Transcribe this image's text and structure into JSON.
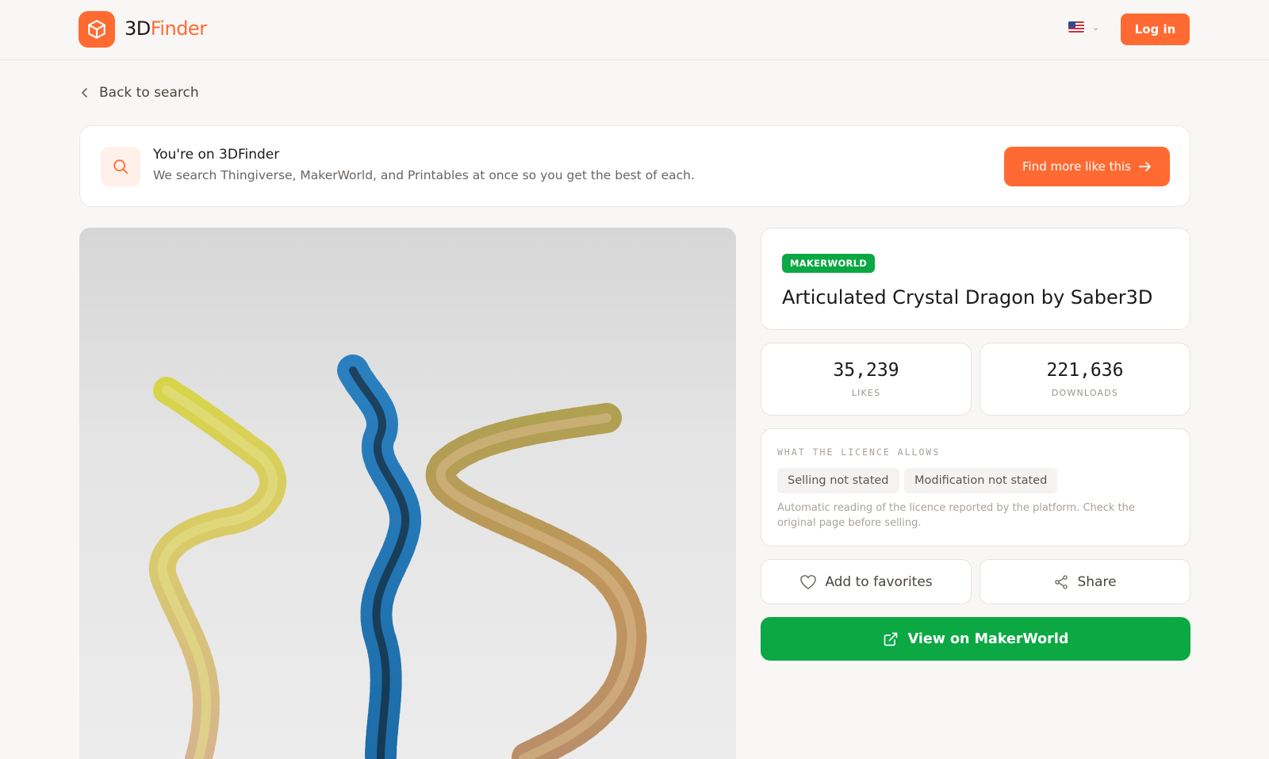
{
  "header": {
    "logo_prefix": "3D",
    "logo_suffix": "Finder",
    "language_icon": "us-flag-icon",
    "login_label": "Log in"
  },
  "back": {
    "label": "Back to search"
  },
  "banner": {
    "title": "You're on 3DFinder",
    "subtitle": "We search Thingiverse, MakerWorld, and Printables at once so you get the best of each.",
    "cta_label": "Find more like this"
  },
  "model": {
    "source_badge": "MAKERWORLD",
    "title": "Articulated Crystal Dragon by Saber3D",
    "likes_value": "35,239",
    "likes_label": "LIKES",
    "downloads_value": "221,636",
    "downloads_label": "DOWNLOADS"
  },
  "licence": {
    "heading": "WHAT THE LICENCE ALLOWS",
    "chips": [
      "Selling not stated",
      "Modification not stated"
    ],
    "note": "Automatic reading of the licence reported by the platform. Check the original page before selling."
  },
  "actions": {
    "favorite_label": "Add to favorites",
    "share_label": "Share",
    "view_label": "View on MakerWorld"
  },
  "colors": {
    "brand_orange": "#ff6a33",
    "makerworld_green": "#0ba843",
    "background": "#f9f7f5"
  }
}
